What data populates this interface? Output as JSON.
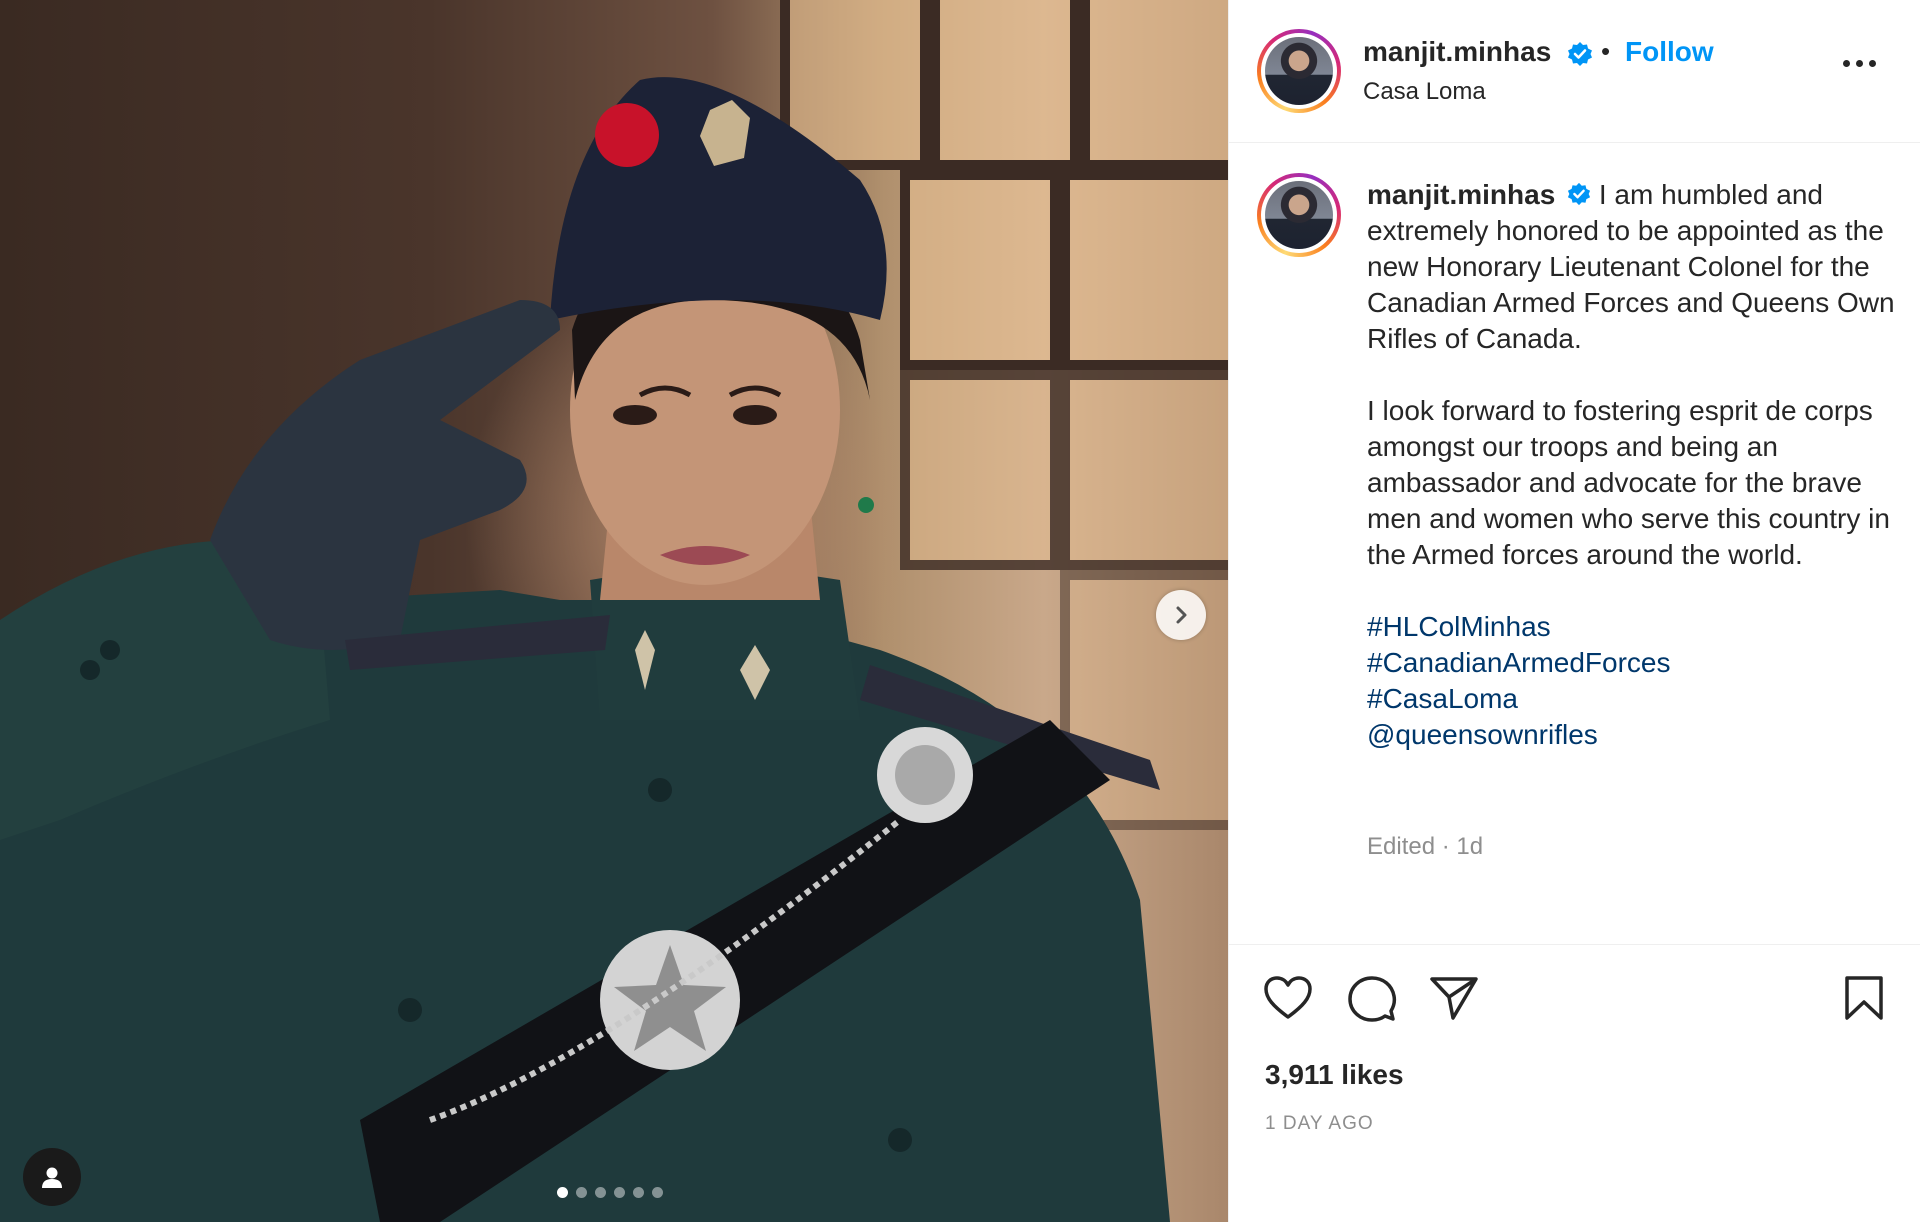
{
  "post": {
    "username": "manjit.minhas",
    "verified": true,
    "separator": "•",
    "follow_label": "Follow",
    "location": "Casa Loma"
  },
  "caption": {
    "username": "manjit.minhas",
    "paragraph1": "I am humbled and extremely honored to be appointed as the new Honorary Lieutenant Colonel for the Canadian Armed Forces and Queens Own Rifles of Canada.",
    "paragraph2": "I look forward to fostering esprit de corps amongst our troops and being an ambassador and advocate for the brave men and women who serve this country in the Armed forces around the world.",
    "tags": [
      "#HLColMinhas",
      "#CanadianArmedForces",
      "#CasaLoma",
      "@queensownrifles"
    ],
    "meta": "Edited · 1d"
  },
  "engagement": {
    "likes": "3,911 likes",
    "date": "1 DAY AGO"
  },
  "carousel": {
    "slide_count": 6,
    "active_index": 0
  },
  "icons": {
    "like": "heart-icon",
    "comment": "comment-icon",
    "share": "paper-plane-icon",
    "save": "bookmark-icon",
    "more": "more-options-icon",
    "next": "chevron-right-icon",
    "tag_user": "user-icon",
    "verified": "verified-badge-icon"
  },
  "colors": {
    "link_blue": "#0095f6",
    "hashtag": "#00376b",
    "verified_badge": "#0095f6",
    "muted": "#8e8e8e",
    "text": "#262626"
  }
}
